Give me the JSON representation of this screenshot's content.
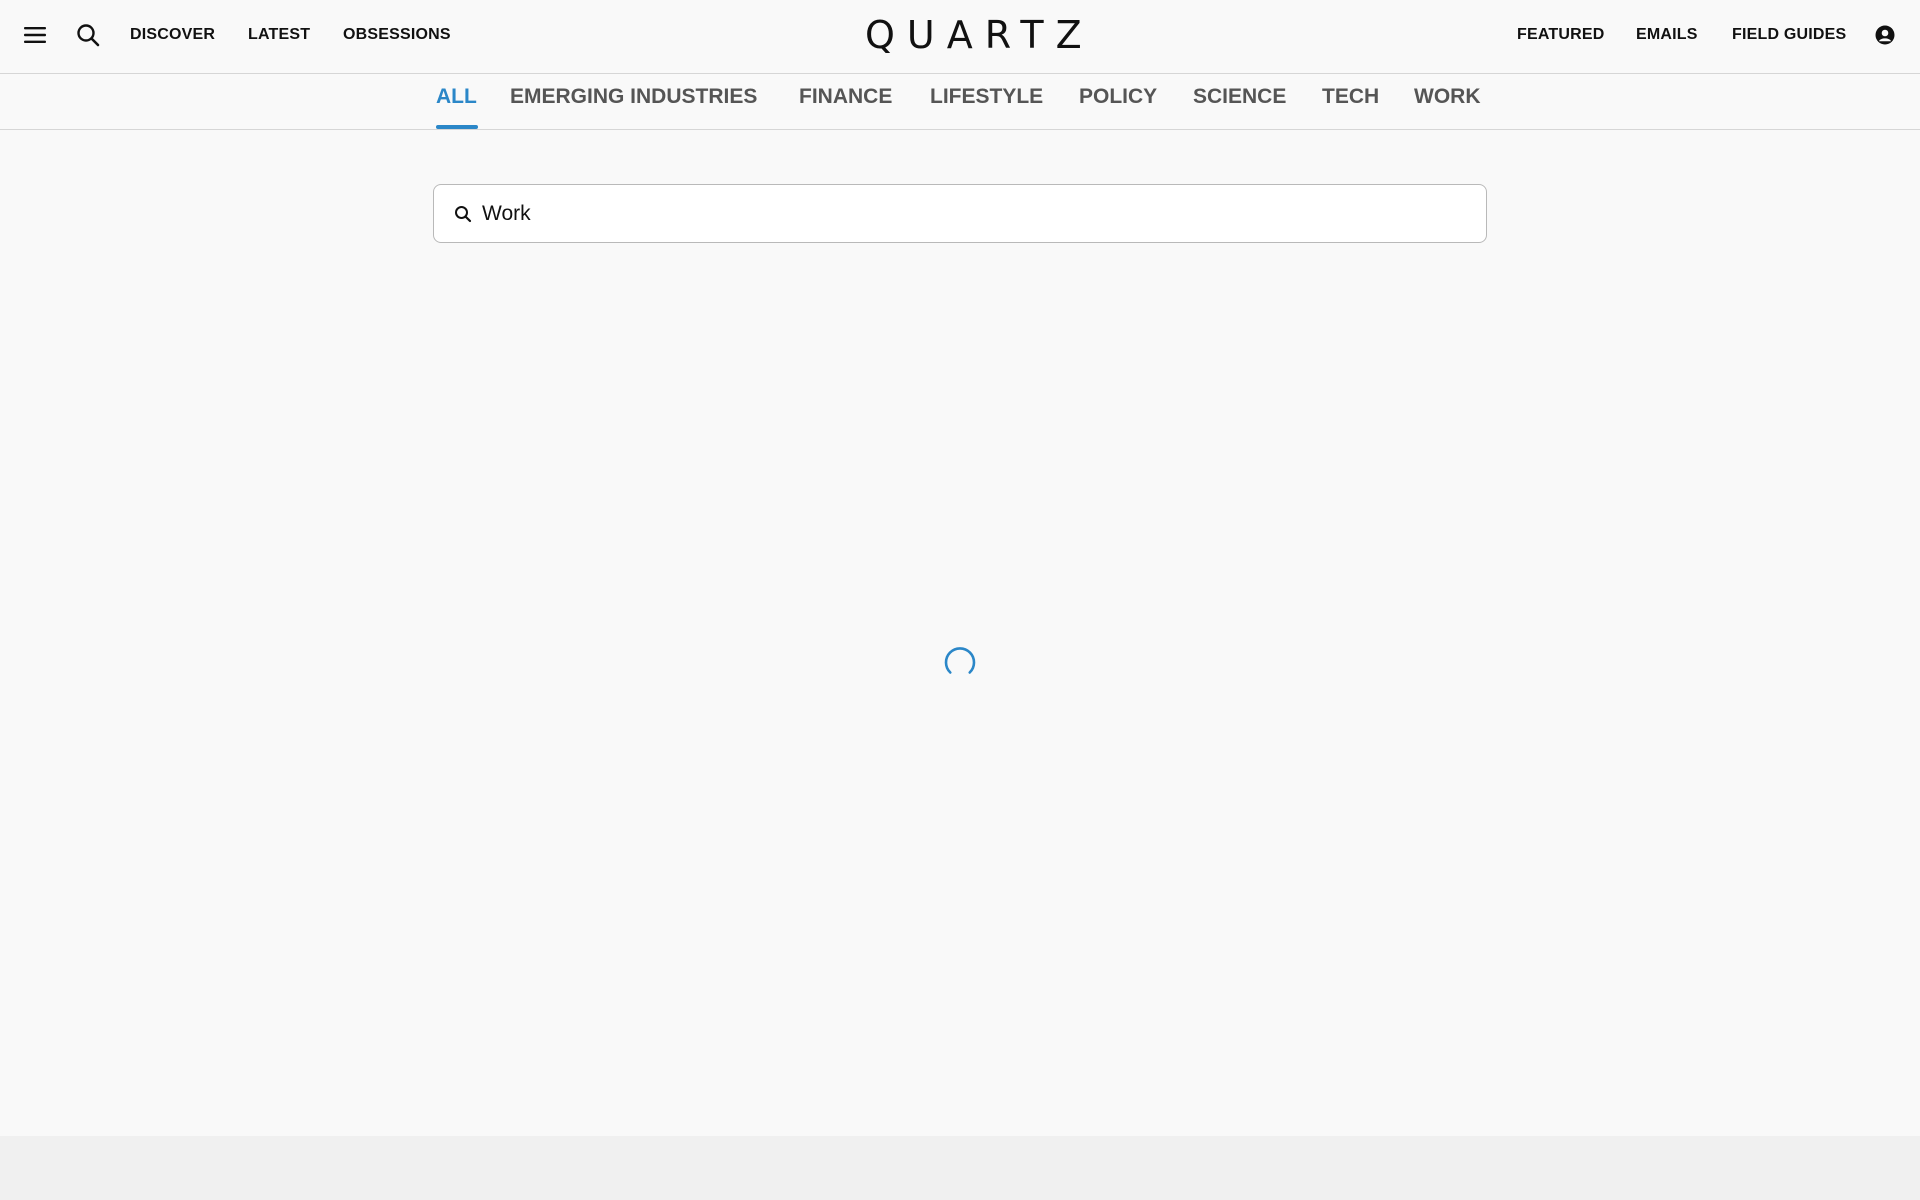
{
  "header": {
    "menu_icon": "hamburger-menu-icon",
    "search_icon": "search-icon",
    "left_nav": [
      {
        "label": "DISCOVER"
      },
      {
        "label": "LATEST"
      },
      {
        "label": "OBSESSIONS"
      }
    ],
    "logo_text": "QUARTZ",
    "right_nav": [
      {
        "label": "FEATURED"
      },
      {
        "label": "EMAILS"
      },
      {
        "label": "FIELD GUIDES"
      }
    ],
    "account_icon": "user-account-icon"
  },
  "tabs": {
    "items": [
      {
        "label": "ALL",
        "active": true
      },
      {
        "label": "EMERGING INDUSTRIES",
        "active": false
      },
      {
        "label": "FINANCE",
        "active": false
      },
      {
        "label": "LIFESTYLE",
        "active": false
      },
      {
        "label": "POLICY",
        "active": false
      },
      {
        "label": "SCIENCE",
        "active": false
      },
      {
        "label": "TECH",
        "active": false
      },
      {
        "label": "WORK",
        "active": false
      }
    ],
    "active_color": "#2b87c8"
  },
  "search": {
    "value": "Work",
    "icon": "search-icon"
  },
  "loading": {
    "icon": "loading-spinner-icon",
    "color": "#2b87c8"
  }
}
